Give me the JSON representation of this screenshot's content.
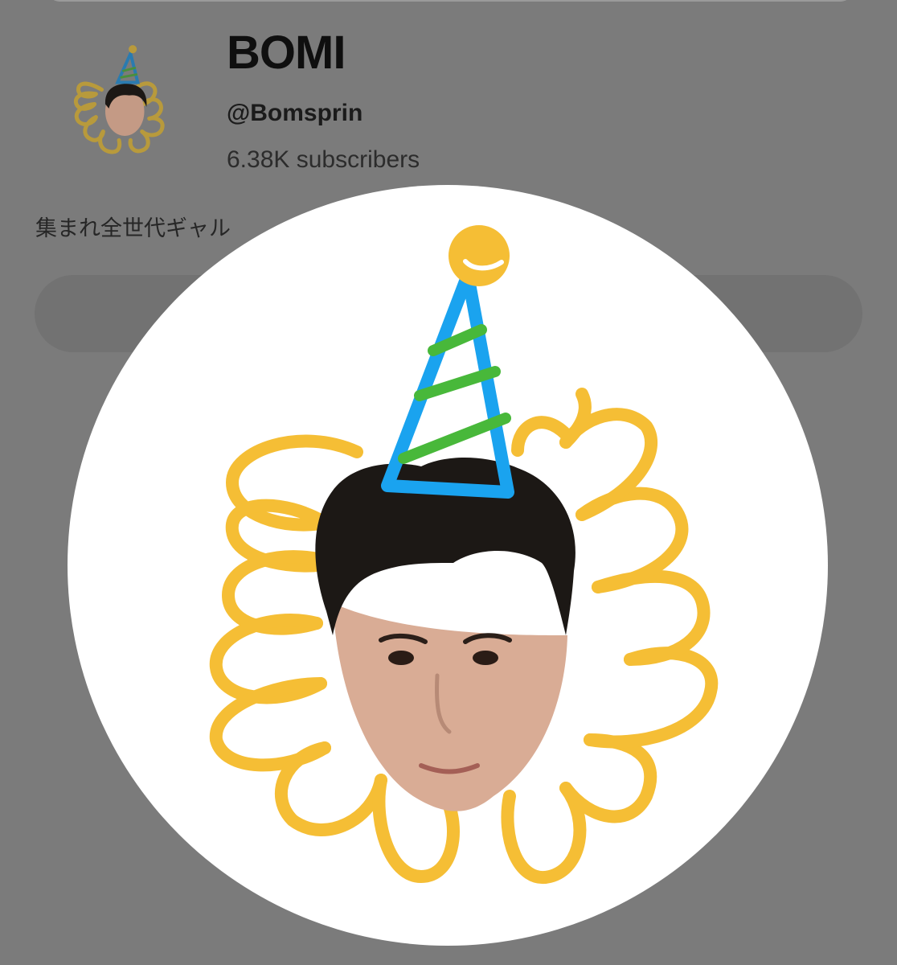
{
  "channel": {
    "name": "BOMI",
    "handle": "@Bomsprin",
    "subscribers": "6.38K subscribers",
    "description": "集まれ全世代ギャル"
  },
  "avatar": {
    "hat_color": "#1aa3ef",
    "hat_stripe_color": "#48b83a",
    "hat_pompom_color": "#f5be35",
    "flower_color": "#f5be35",
    "hair_color": "#1c1815",
    "skin_color": "#d9ac95"
  },
  "colors": {
    "overlay_background": "#7b7b7b",
    "avatar_background": "#ffffff"
  }
}
